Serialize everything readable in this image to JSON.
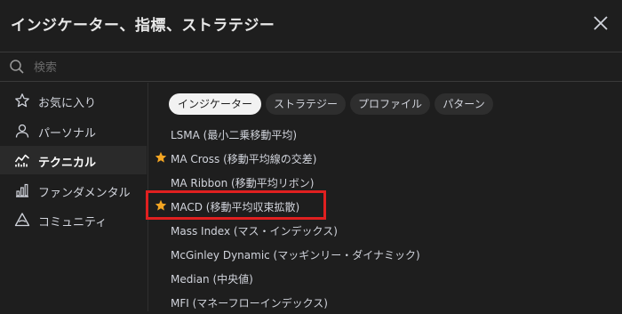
{
  "dialog": {
    "title": "インジケーター、指標、ストラテジー"
  },
  "search": {
    "placeholder": "検索"
  },
  "sidebar": {
    "items": [
      {
        "label": "お気に入り",
        "icon": "star-outline-icon"
      },
      {
        "label": "パーソナル",
        "icon": "user-icon"
      },
      {
        "label": "テクニカル",
        "icon": "chart-line-icon",
        "active": true
      },
      {
        "label": "ファンダメンタル",
        "icon": "bar-chart-icon"
      },
      {
        "label": "コミュニティ",
        "icon": "community-icon"
      }
    ]
  },
  "tabs": [
    {
      "label": "インジケーター",
      "active": true
    },
    {
      "label": "ストラテジー"
    },
    {
      "label": "プロファイル"
    },
    {
      "label": "パターン"
    }
  ],
  "indicators": [
    {
      "label": "LSMA (最小二乗移動平均)",
      "favorite": false
    },
    {
      "label": "MA Cross (移動平均線の交差)",
      "favorite": true
    },
    {
      "label": "MA Ribbon (移動平均リボン)",
      "favorite": false
    },
    {
      "label": "MACD (移動平均収束拡散)",
      "favorite": true,
      "highlighted": true
    },
    {
      "label": "Mass Index (マス・インデックス)",
      "favorite": false
    },
    {
      "label": "McGinley Dynamic (マッギンリー・ダイナミック)",
      "favorite": false
    },
    {
      "label": "Median (中央値)",
      "favorite": false
    },
    {
      "label": "MFI (マネーフローインデックス)",
      "favorite": false
    }
  ],
  "colors": {
    "background": "#1e1e1e",
    "star": "#f5a623",
    "highlight": "#e02020"
  }
}
